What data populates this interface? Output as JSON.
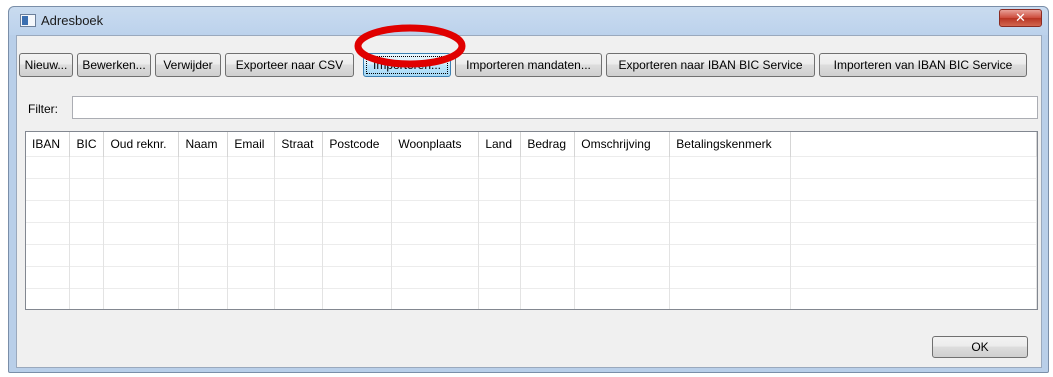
{
  "window": {
    "title": "Adresboek",
    "close_label": "✕"
  },
  "toolbar": {
    "buttons": [
      "Nieuw...",
      "Bewerken...",
      "Verwijder",
      "Exporteer naar CSV",
      "Importeren...",
      "Importeren mandaten...",
      "Exporteren naar IBAN BIC Service",
      "Importeren van IBAN BIC Service"
    ]
  },
  "filter": {
    "label": "Filter:",
    "value": ""
  },
  "table": {
    "columns": [
      "IBAN",
      "BIC",
      "Oud reknr.",
      "Naam",
      "Email",
      "Straat",
      "Postcode",
      "Woonplaats",
      "Land",
      "Bedrag",
      "Omschrijving",
      "Betalingskenmerk",
      ""
    ]
  },
  "footer": {
    "ok_label": "OK"
  },
  "annotation": {
    "color": "#e00000"
  }
}
